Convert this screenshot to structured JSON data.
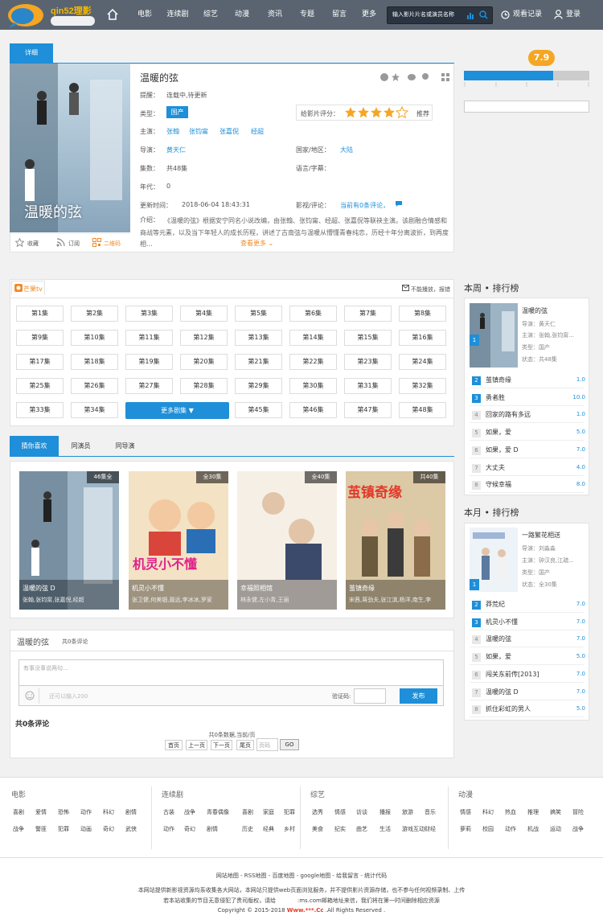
{
  "header": {
    "logo_text": "qin52理影",
    "nav": [
      "电影",
      "连续剧",
      "综艺",
      "动漫",
      "资讯",
      "专题",
      "留言",
      "更多"
    ],
    "search_placeholder": "输入影片片名或演员名称",
    "history": "观看记录",
    "login": "登录"
  },
  "detail": {
    "tab": "详细",
    "title": "温暖的弦",
    "reminder_label": "提醒：",
    "reminder": "连载中,待更新",
    "type_label": "类型：",
    "type": "国产",
    "rate_label": "给影片评分：",
    "rate_btn": "推荐",
    "stars": 4,
    "cast_label": "主演：",
    "cast": [
      "张翰",
      "张钧甯",
      "张嘉倪",
      "经超"
    ],
    "director_label": "导演：",
    "director": "黄天仁",
    "region_label": "国家/地区：",
    "region": "大陆",
    "episodes_label": "集数：",
    "episodes": "共48集",
    "lang_label": "语言/字幕：",
    "lang": "",
    "year_label": "年代：",
    "year": "0",
    "update_label": "更新时间：",
    "update": "2018-06-04 18:43:31",
    "review_label": "影视/评论：",
    "review": "当前有0条评论，",
    "intro_label": "介绍：",
    "intro": "《温暖的弦》根据安宁同名小说改编，由张翰、张钧甯、经超、张嘉倪等联袂主演。该剧融合情感和商战等元素，以及当下年轻人的成长历程，讲述了古南弦与温暖从懵懂青春纯恋，历经十年分离波折，到再度相...",
    "more": "查看更多",
    "score": "7.9",
    "actions": [
      "收藏",
      "订阅",
      "二维码"
    ],
    "poster_text": "温暖的弦"
  },
  "play": {
    "source": "芒果tv",
    "report": "不能播放，报错",
    "episodes": [
      "第1集",
      "第2集",
      "第3集",
      "第4集",
      "第5集",
      "第6集",
      "第7集",
      "第8集",
      "第9集",
      "第10集",
      "第11集",
      "第12集",
      "第13集",
      "第14集",
      "第15集",
      "第16集",
      "第17集",
      "第18集",
      "第19集",
      "第20集",
      "第21集",
      "第22集",
      "第23集",
      "第24集",
      "第25集",
      "第26集",
      "第27集",
      "第28集",
      "第29集",
      "第30集",
      "第31集",
      "第32集",
      "第33集",
      "第34集",
      "第45集",
      "第46集",
      "第47集",
      "第48集"
    ],
    "more_btn": "更多剧集"
  },
  "recommend": {
    "tabs": [
      "猜你喜欢",
      "同演员",
      "同导演"
    ],
    "items": [
      {
        "title": "温暖的弦 D",
        "cast": "张翰,张钧甯,张嘉倪,经超",
        "badge": "46集全"
      },
      {
        "title": "机灵小不懂",
        "cast": "张卫健,何美钿,聂远,李冰冰,罗家",
        "badge": "全30集"
      },
      {
        "title": "幸福照相馆",
        "cast": "林永健,左小青,王丽",
        "badge": "全40集"
      },
      {
        "title": "茧镇奇缘",
        "cast": "宋茜,蒋劲夫,张江滨,杨洋,南生,李",
        "badge": "共40集"
      }
    ]
  },
  "comments": {
    "title": "温暖的弦",
    "count": "共0条评论",
    "placeholder": "有事没事说两句...",
    "hint": "还可以输入200",
    "captcha_label": "验证码:",
    "submit": "发布",
    "total": "共0条评论",
    "pager_info": "共0条数据,当前/页",
    "pager": [
      "首页",
      "上一页",
      "下一页",
      "尾页"
    ],
    "page_placeholder": "页码",
    "go": "GO"
  },
  "rank_week": {
    "title": "本周 • 排行榜",
    "feature": {
      "name": "温暖的弦",
      "director": "导演：黄天仁",
      "cast": "主演：张翰,张钧甯...",
      "type": "类型：国产",
      "status": "状态：共48集"
    },
    "items": [
      {
        "n": "2",
        "t": "茧镇奇缘",
        "s": "1.0"
      },
      {
        "n": "3",
        "t": "勇者胜",
        "s": "10.0"
      },
      {
        "n": "4",
        "t": "回家的路有多远",
        "s": "1.0"
      },
      {
        "n": "5",
        "t": "如果，爱",
        "s": "5.0"
      },
      {
        "n": "6",
        "t": "如果，爱 D",
        "s": "7.0"
      },
      {
        "n": "7",
        "t": "大丈夫",
        "s": "4.0"
      },
      {
        "n": "8",
        "t": "守候幸福",
        "s": "8.0"
      }
    ]
  },
  "rank_month": {
    "title": "本月 • 排行榜",
    "feature": {
      "name": "一路繁花相送",
      "director": "导演：刘淼淼",
      "cast": "主演：钟汉良,江疏...",
      "type": "类型：国产",
      "status": "状态：全30集"
    },
    "items": [
      {
        "n": "2",
        "t": "莽荒纪",
        "s": "7.0"
      },
      {
        "n": "3",
        "t": "机灵小不懂",
        "s": "7.0"
      },
      {
        "n": "4",
        "t": "温暖的弦",
        "s": "7.0"
      },
      {
        "n": "5",
        "t": "如果，爱",
        "s": "5.0"
      },
      {
        "n": "6",
        "t": "闯关东前传[2013]",
        "s": "7.0"
      },
      {
        "n": "7",
        "t": "温暖的弦 D",
        "s": "7.0"
      },
      {
        "n": "8",
        "t": "抓住彩虹的男人",
        "s": "5.0"
      }
    ]
  },
  "footer_cats": [
    {
      "title": "电影",
      "links": [
        "喜剧",
        "爱情",
        "恐怖",
        "动作",
        "科幻",
        "剧情",
        "战争",
        "警匪",
        "犯罪",
        "动画",
        "奇幻",
        "武侠"
      ]
    },
    {
      "title": "连续剧",
      "links": [
        "古装",
        "战争",
        "青春偶像",
        "喜剧",
        "家庭",
        "犯罪",
        "动作",
        "奇幻",
        "剧情",
        "历史",
        "经典",
        "乡村"
      ]
    },
    {
      "title": "综艺",
      "links": [
        "选秀",
        "情感",
        "访谈",
        "播报",
        "旅游",
        "音乐",
        "美食",
        "纪实",
        "曲艺",
        "生活",
        "游戏互动",
        "财经"
      ]
    },
    {
      "title": "动漫",
      "links": [
        "情感",
        "科幻",
        "热血",
        "推理",
        "搞笑",
        "冒险",
        "萝莉",
        "校园",
        "动作",
        "机战",
        "运动",
        "战争"
      ]
    }
  ],
  "footer": {
    "links": "网站地图 - RSS地图 - 百度地图 - google地图 - 给我留言 - 统计代码",
    "line1": "本网站提供新影视资源均系收集各大网站，本网站只提供web页面浏览服务，并不提供影片资源存储，也不参与任何视频录制、上传",
    "line2": "若本站收集的节目无意侵犯了贵司版权，请给            :ms.com邮箱地址来信，我们将在第一时间删除相应资源",
    "copyright_pre": "Copyright © 2015-2018 ",
    "copyright_site": "Www.***.Cc",
    "copyright_post": " .All Rights Reserved ."
  }
}
